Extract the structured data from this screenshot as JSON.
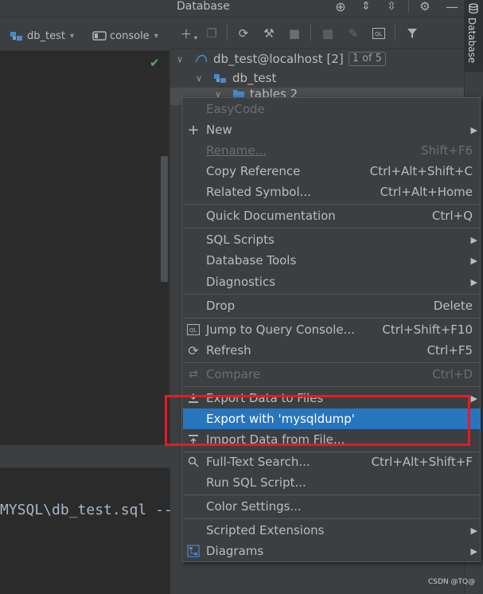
{
  "left_toolbar": {
    "datasource_label": "db_test",
    "console_label": "console"
  },
  "console": {
    "path_line": "MYSQL\\db_test.sql --"
  },
  "db_panel": {
    "title": "Database",
    "strip_label": "Database",
    "tree": [
      {
        "label": "db_test@localhost [2]",
        "badge": "1 of 5"
      },
      {
        "label": "db_test"
      },
      {
        "label": "tables  2"
      }
    ]
  },
  "context_menu": {
    "items": [
      {
        "label": "EasyCode",
        "disabled": true
      },
      {
        "label": "New",
        "icon": "plus-icon",
        "submenu": true
      },
      {
        "label": "Rename...",
        "shortcut": "Shift+F6",
        "disabled": true
      },
      {
        "label": "Copy Reference",
        "shortcut": "Ctrl+Alt+Shift+C"
      },
      {
        "label": "Related Symbol...",
        "shortcut": "Ctrl+Alt+Home"
      },
      {
        "label": "Quick Documentation",
        "shortcut": "Ctrl+Q"
      },
      {
        "label": "SQL Scripts",
        "submenu": true
      },
      {
        "label": "Database Tools",
        "submenu": true
      },
      {
        "label": "Diagnostics",
        "submenu": true
      },
      {
        "label": "Drop",
        "shortcut": "Delete"
      },
      {
        "label": "Jump to Query Console...",
        "shortcut": "Ctrl+Shift+F10",
        "icon": "query-console-icon"
      },
      {
        "label": "Refresh",
        "shortcut": "Ctrl+F5",
        "icon": "refresh-icon"
      },
      {
        "label": "Compare",
        "shortcut": "Ctrl+D",
        "icon": "compare-icon",
        "disabled": true
      },
      {
        "label": "Export Data to Files",
        "icon": "export-icon",
        "submenu": true
      },
      {
        "label": "Export with 'mysqldump'",
        "active": true
      },
      {
        "label": "Import Data from File...",
        "icon": "import-icon"
      },
      {
        "label": "Full-Text Search...",
        "shortcut": "Ctrl+Alt+Shift+F",
        "icon": "search-icon"
      },
      {
        "label": "Run SQL Script..."
      },
      {
        "label": "Color Settings..."
      },
      {
        "label": "Scripted Extensions",
        "submenu": true
      },
      {
        "label": "Diagrams",
        "icon": "diagram-icon",
        "submenu": true
      }
    ]
  },
  "watermark": "CSDN @TQ@",
  "colors": {
    "menu_bg": "#3c3f41",
    "active_item": "#2675bf",
    "highlight_box": "#e81a24",
    "check": "#59a869"
  }
}
